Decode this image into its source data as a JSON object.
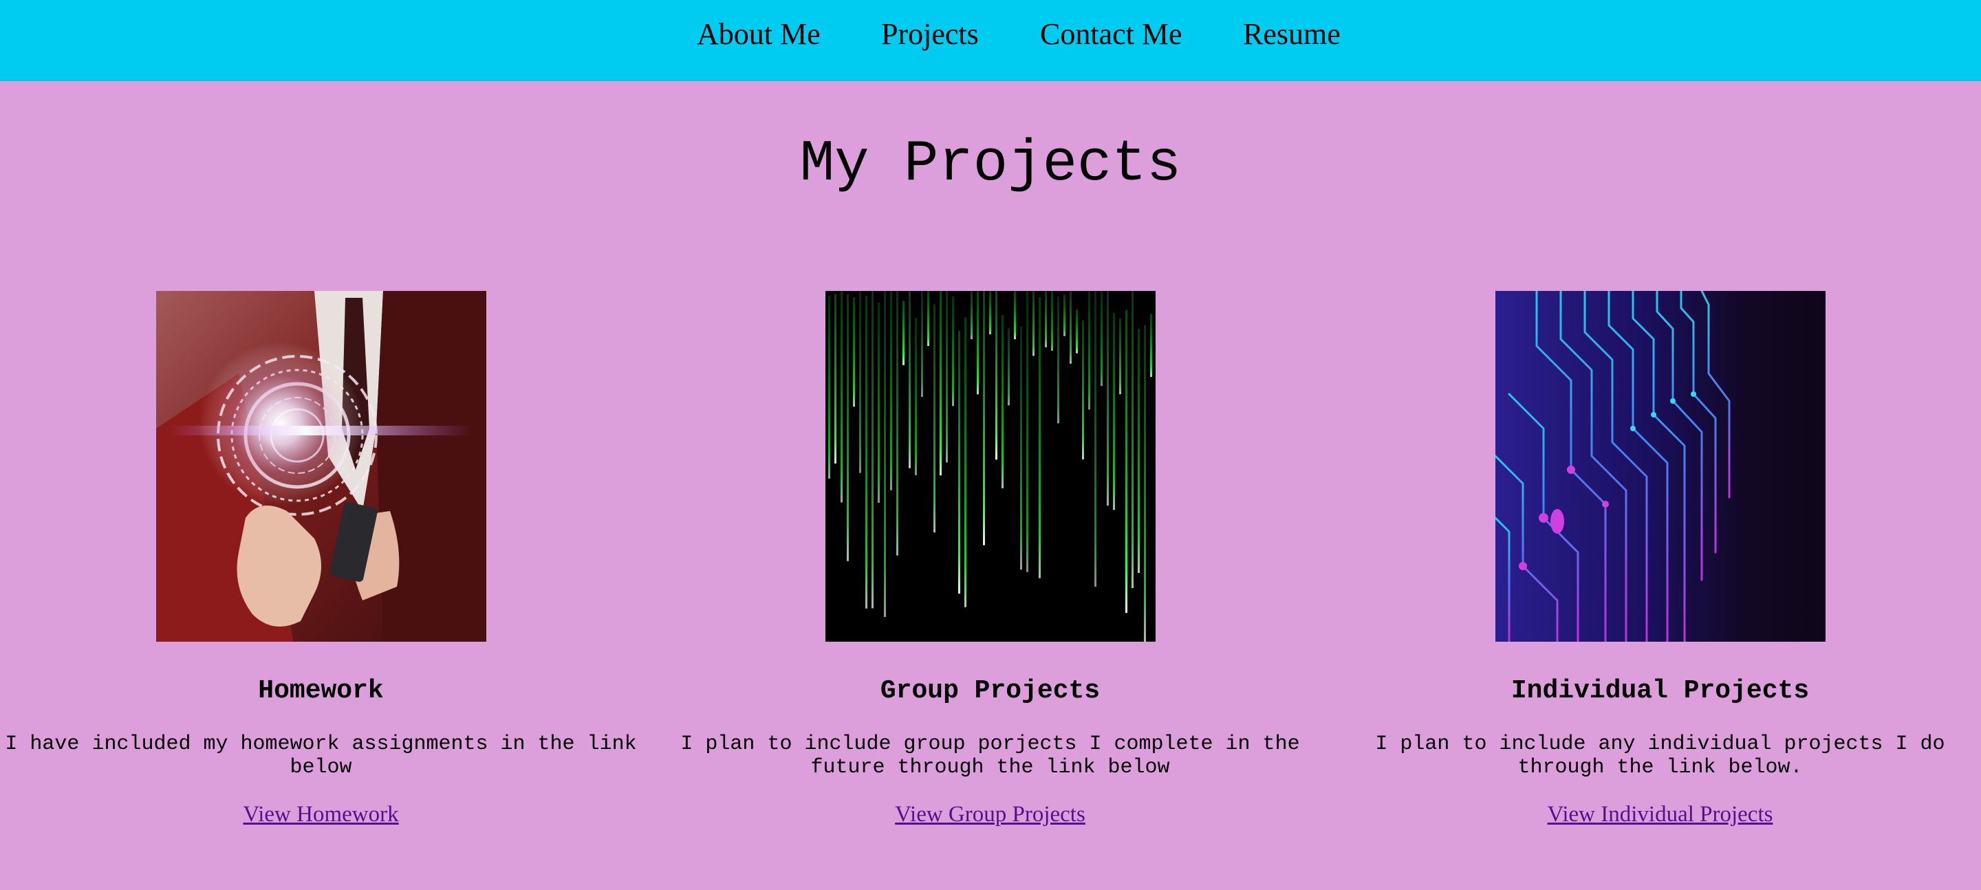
{
  "nav": {
    "items": [
      {
        "label": "About Me"
      },
      {
        "label": "Projects"
      },
      {
        "label": "Contact Me"
      },
      {
        "label": "Resume"
      }
    ]
  },
  "main": {
    "title": "My Projects",
    "cards": [
      {
        "image_icon": "hand-holding-phone-hologram-image",
        "title": "Homework",
        "text": "I have included my homework assignments in the link below",
        "link": "View Homework"
      },
      {
        "image_icon": "green-code-rain-image",
        "title": "Group Projects",
        "text": "I plan to include group porjects I complete in the future through the link below",
        "link": "View Group Projects"
      },
      {
        "image_icon": "circuit-board-image",
        "title": "Individual Projects",
        "text": "I plan to include any individual projects I do through the link below.",
        "link": "View Individual Projects"
      }
    ]
  },
  "colors": {
    "page_background": "#dd9fdc",
    "navbar_background": "#00ccf2",
    "link_color": "#55118b",
    "text_color": "#000000"
  }
}
